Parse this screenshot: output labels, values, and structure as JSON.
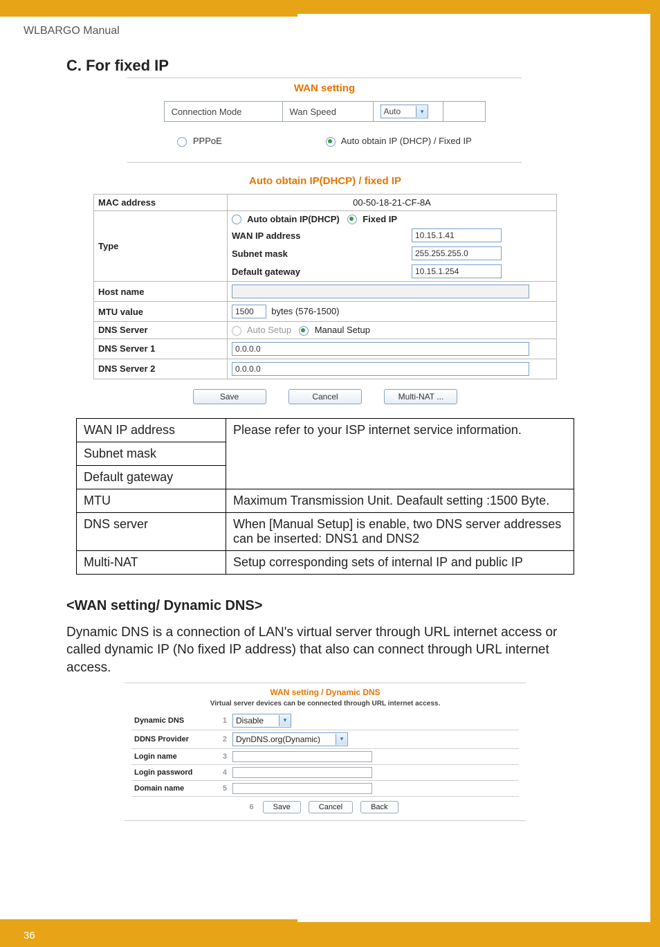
{
  "manual_title": "WLBARGO Manual",
  "section_heading": "C. For fixed IP",
  "wan_setting": {
    "title": "WAN setting",
    "row": {
      "conn_mode_label": "Connection Mode",
      "wan_speed_label": "Wan Speed",
      "wan_speed_value": "Auto"
    },
    "radios": {
      "pppoe": "PPPoE",
      "dhcp_fixed": "Auto obtain IP (DHCP) / Fixed IP"
    }
  },
  "auto_obtain": {
    "title": "Auto obtain IP(DHCP) / fixed IP",
    "mac_label": "MAC address",
    "mac_value": "00-50-18-21-CF-8A",
    "type_label": "Type",
    "type_radio1": "Auto obtain IP(DHCP)",
    "type_radio2": "Fixed IP",
    "wan_ip_label": "WAN IP address",
    "wan_ip_value": "10.15.1.41",
    "subnet_label": "Subnet mask",
    "subnet_value": "255.255.255.0",
    "gateway_label": "Default gateway",
    "gateway_value": "10.15.1.254",
    "host_label": "Host name",
    "mtu_label": "MTU value",
    "mtu_value": "1500",
    "mtu_hint": "bytes (576-1500)",
    "dns_server_label": "DNS Server",
    "dns_auto": "Auto Setup",
    "dns_manual": "Manaul Setup",
    "dns1_label": "DNS Server 1",
    "dns1_value": "0.0.0.0",
    "dns2_label": "DNS Server 2",
    "dns2_value": "0.0.0.0",
    "btn_save": "Save",
    "btn_cancel": "Cancel",
    "btn_multinat": "Multi-NAT ..."
  },
  "desc_table": [
    {
      "k": "WAN IP address",
      "v": "Please refer to your ISP internet service information.",
      "rowspan": 3
    },
    {
      "k": "Subnet mask"
    },
    {
      "k": "Default gateway"
    },
    {
      "k": "MTU",
      "v": "Maximum Transmission Unit. Deafault setting :1500 Byte."
    },
    {
      "k": "DNS server",
      "v": "When [Manual Setup] is enable, two DNS server addresses can be inserted: DNS1 and DNS2"
    },
    {
      "k": "Multi-NAT",
      "v": "Setup corresponding sets of internal IP and public IP"
    }
  ],
  "ddns_section": {
    "heading": "<WAN setting/ Dynamic DNS>",
    "paragraph": "Dynamic DNS is a connection of LAN's virtual server through URL internet access or called dynamic IP (No fixed IP address) that also can connect through URL internet access.",
    "title": "WAN setting / Dynamic DNS",
    "subtitle": "Virtual server devices can be connected through URL internet access.",
    "rows": {
      "r1_label": "Dynamic DNS",
      "r1_value": "Disable",
      "r2_label": "DDNS Provider",
      "r2_value": "DynDNS.org(Dynamic)",
      "r3_label": "Login name",
      "r4_label": "Login password",
      "r5_label": "Domain name"
    },
    "numbers": [
      "1",
      "2",
      "3",
      "4",
      "5",
      "6"
    ],
    "btn_save": "Save",
    "btn_cancel": "Cancel",
    "btn_back": "Back"
  },
  "page_number": "36"
}
